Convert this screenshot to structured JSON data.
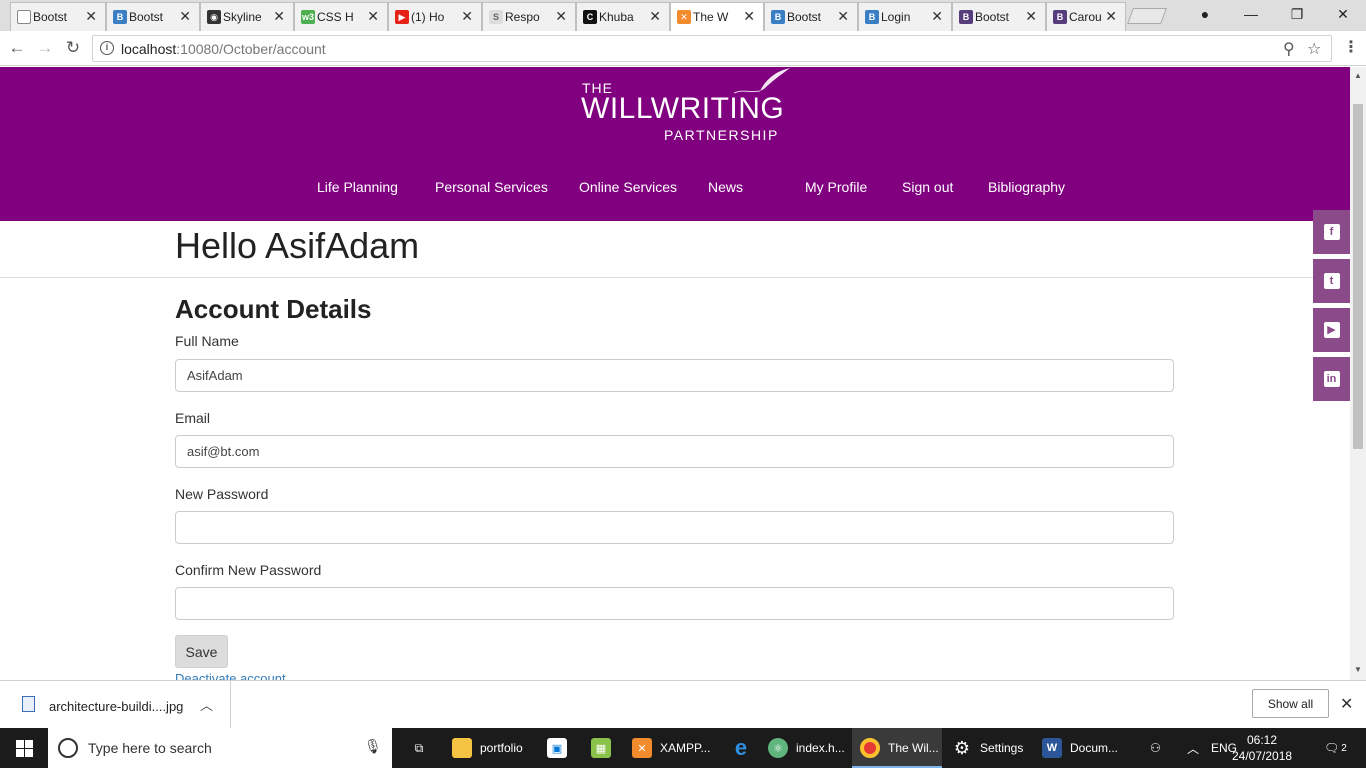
{
  "browser": {
    "tabs": [
      {
        "title": "Bootst",
        "favicon": "page-icon",
        "color": "#888888"
      },
      {
        "title": "Bootst",
        "favicon": "bootstrap-b-icon",
        "color": "#3a7fc4"
      },
      {
        "title": "Skyline",
        "favicon": "camera-icon",
        "color": "#333333"
      },
      {
        "title": "CSS H",
        "favicon": "w3-icon",
        "color": "#4caf50"
      },
      {
        "title": "(1) Ho",
        "favicon": "youtube-icon",
        "color": "#e62117"
      },
      {
        "title": "Respo",
        "favicon": "respo-icon",
        "color": "#999999"
      },
      {
        "title": "Khuba",
        "favicon": "c-icon",
        "color": "#111111"
      },
      {
        "title": "The W",
        "favicon": "xampp-icon",
        "color": "#f28b2c",
        "active": true
      },
      {
        "title": "Bootst",
        "favicon": "bootstrap-b-icon",
        "color": "#3a7fc4"
      },
      {
        "title": "Login",
        "favicon": "bootstrap-b-icon",
        "color": "#3a7fc4"
      },
      {
        "title": "Bootst",
        "favicon": "bootstrap-icon",
        "color": "#563d7c"
      },
      {
        "title": "Carou",
        "favicon": "bootstrap-icon",
        "color": "#563d7c"
      }
    ],
    "url_host": "localhost",
    "url_path": ":10080/October/account"
  },
  "site": {
    "logo": {
      "the": "THE",
      "main": "WILLWRITING",
      "sub": "PARTNERSHIP"
    },
    "nav": [
      "Life Planning",
      "Personal Services",
      "Online Services",
      "News",
      "My Profile",
      "Sign out",
      "Bibliography"
    ],
    "greeting": "Hello AsifAdam",
    "section_title": "Account Details",
    "form": {
      "full_name_label": "Full Name",
      "full_name_value": "AsifAdam",
      "email_label": "Email",
      "email_value": "asif@bt.com",
      "new_password_label": "New Password",
      "new_password_value": "",
      "confirm_password_label": "Confirm New Password",
      "confirm_password_value": "",
      "save_label": "Save",
      "deactivate_label": "Deactivate account"
    },
    "social": [
      "facebook-icon",
      "twitter-icon",
      "youtube-icon",
      "linkedin-icon"
    ],
    "brand_color": "#80007f"
  },
  "downloads": {
    "file_name": "architecture-buildi....jpg",
    "show_all_label": "Show all"
  },
  "taskbar": {
    "search_placeholder": "Type here to search",
    "apps": [
      {
        "label": "portfolio",
        "icon": "folder-icon"
      },
      {
        "label": "XAMPP...",
        "icon": "xampp-icon"
      },
      {
        "label": "index.h...",
        "icon": "atom-icon"
      },
      {
        "label": "The Wil...",
        "icon": "chrome-icon"
      },
      {
        "label": "Settings",
        "icon": "gear-icon"
      },
      {
        "label": "Docum...",
        "icon": "word-icon"
      }
    ],
    "language": "ENG",
    "time": "06:12",
    "date": "24/07/2018",
    "notification_count": "2"
  }
}
